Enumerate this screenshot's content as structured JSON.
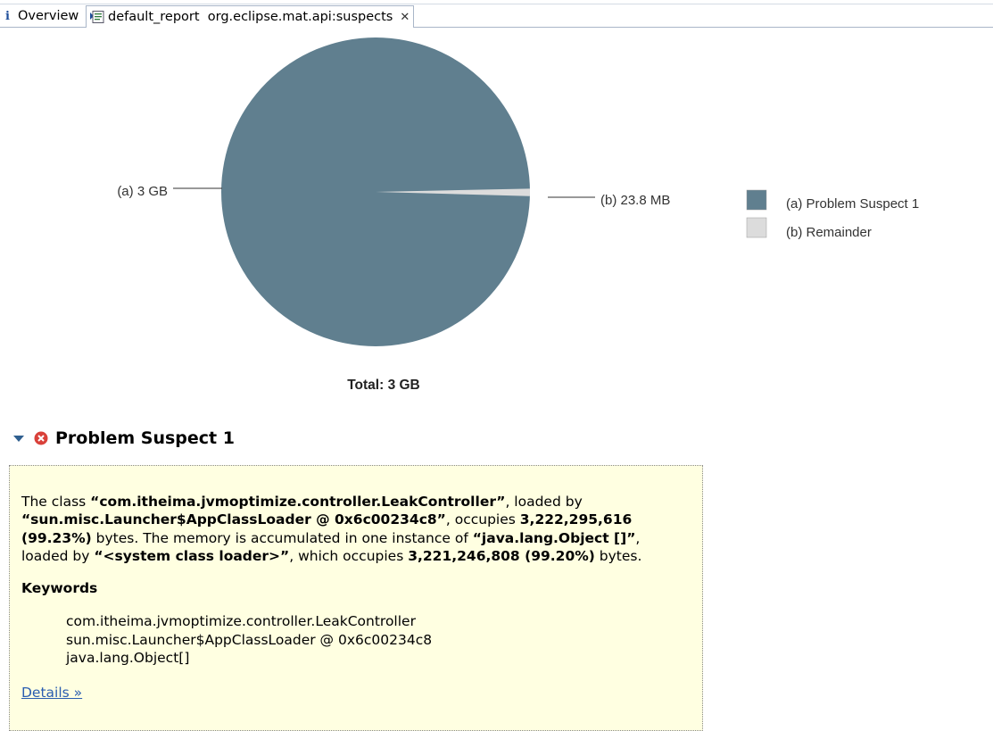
{
  "tabs": [
    {
      "label": "Overview",
      "icon": "info-icon"
    },
    {
      "label": "default_report  org.eclipse.mat.api:suspects",
      "icon": "report-icon",
      "closable": true
    }
  ],
  "chart_data": {
    "type": "pie",
    "slices": [
      {
        "letter": "(a)",
        "name": "Problem Suspect 1",
        "value_label": "3 GB",
        "value_bytes": 3222295616,
        "color": "#607f8f"
      },
      {
        "letter": "(b)",
        "name": "Remainder",
        "value_label": "23.8 MB",
        "value_bytes": 24956774,
        "color": "#dcdcdc"
      }
    ],
    "slice_labels": [
      "(a)  3 GB",
      "(b)  23.8 MB"
    ],
    "legend": [
      "(a)  Problem Suspect 1",
      "(b)  Remainder"
    ],
    "legend_position": "right",
    "total_label": "Total: 3 GB"
  },
  "suspect": {
    "title": "Problem Suspect 1",
    "desc": {
      "t1": "The class ",
      "b1": "“com.itheima.jvmoptimize.controller.LeakController”",
      "t2": ", loaded by ",
      "b2": "“sun.misc.Launcher$AppClassLoader @ 0x6c00234c8”",
      "t3": ", occupies ",
      "b3": "3,222,295,616 (99.23%)",
      "t4": " bytes. The memory is accumulated in one instance of ",
      "b4": "“java.lang.Object []”",
      "t5": ", loaded by ",
      "b5": "“<system class loader>”",
      "t6": ", which occupies ",
      "b6": "3,221,246,808 (99.20%)",
      "t7": " bytes."
    },
    "keywords_title": "Keywords",
    "keywords": [
      "com.itheima.jvmoptimize.controller.LeakController",
      "sun.misc.Launcher$AppClassLoader @ 0x6c00234c8",
      "java.lang.Object[]"
    ],
    "details_label": "Details »"
  }
}
